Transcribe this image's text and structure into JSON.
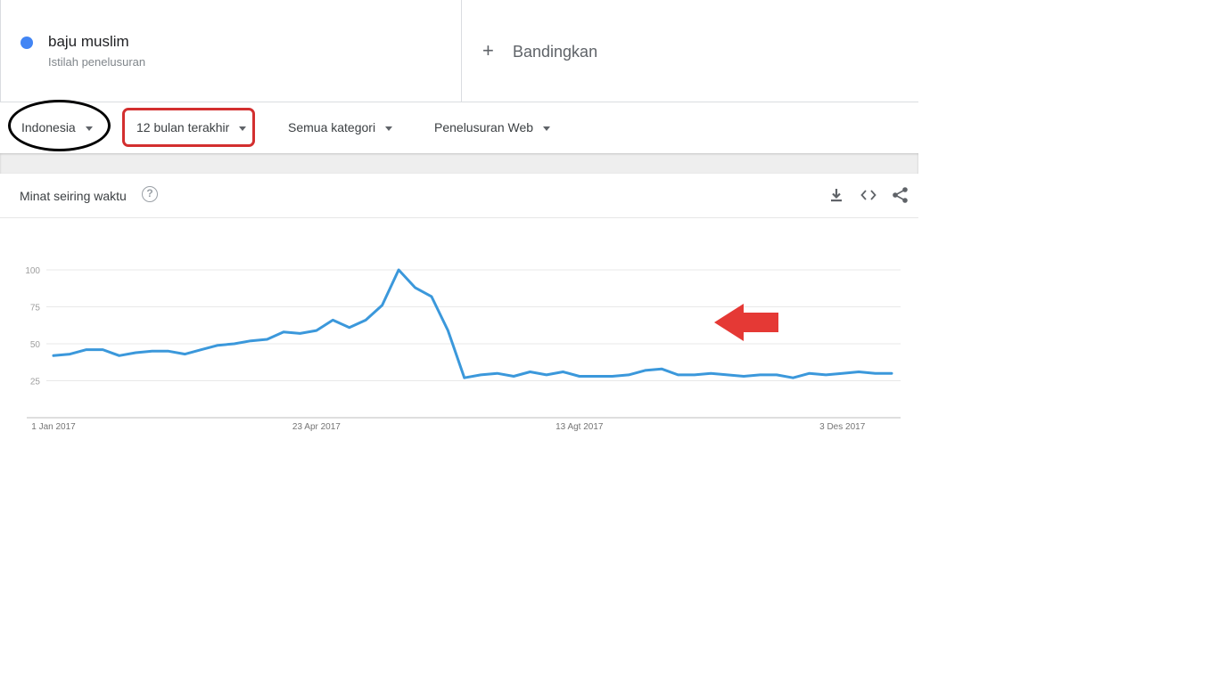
{
  "term": {
    "name": "baju muslim",
    "subtitle": "Istilah penelusuran",
    "color": "#4285f4"
  },
  "compare": {
    "plus": "+",
    "label": "Bandingkan"
  },
  "filters": {
    "region": "Indonesia",
    "time": "12 bulan terakhir",
    "category": "Semua kategori",
    "search_type": "Penelusuran Web"
  },
  "card": {
    "title": "Minat seiring waktu",
    "help": "?",
    "icons": [
      "download-icon",
      "embed-icon",
      "share-icon"
    ]
  },
  "annotations": {
    "ellipse_color": "#000000",
    "rect_color": "#d32f2f",
    "arrow_color": "#e53935"
  },
  "chart_data": {
    "type": "line",
    "title": "",
    "xlabel": "",
    "ylabel": "",
    "ylim": [
      0,
      100
    ],
    "yticks": [
      25,
      50,
      75,
      100
    ],
    "xticks": [
      "1 Jan 2017",
      "23 Apr 2017",
      "13 Agt 2017",
      "3 Des 2017"
    ],
    "x_tick_indices": [
      0,
      16,
      32,
      48
    ],
    "grid": true,
    "line_color": "#3b98db",
    "series": [
      {
        "values": [
          42,
          43,
          46,
          46,
          42,
          44,
          45,
          45,
          43,
          46,
          49,
          50,
          52,
          53,
          58,
          57,
          59,
          66,
          61,
          66,
          76,
          100,
          88,
          82,
          59,
          27,
          29,
          30,
          28,
          31,
          29,
          31,
          28,
          28,
          28,
          29,
          32,
          33,
          29,
          29,
          30,
          29,
          28,
          29,
          29,
          27,
          30,
          29,
          30,
          31,
          30,
          30
        ]
      }
    ]
  }
}
